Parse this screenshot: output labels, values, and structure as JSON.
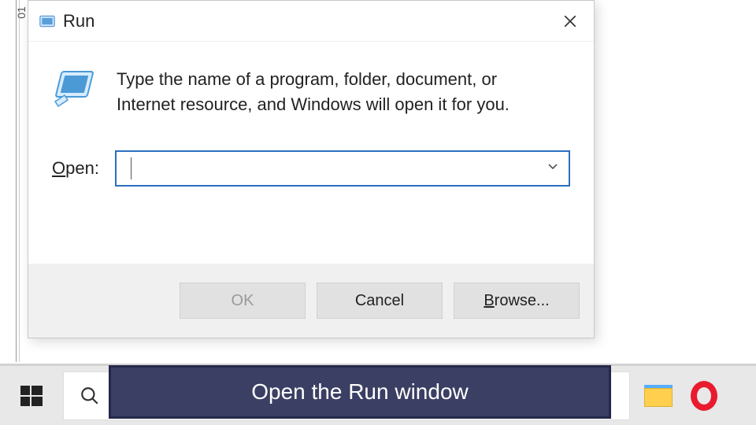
{
  "page_number": "01",
  "dialog": {
    "title": "Run",
    "description": "Type the name of a program, folder, document, or Internet resource, and Windows will open it for you.",
    "open_label_underlined": "O",
    "open_label_rest": "pen:",
    "input_value": "",
    "buttons": {
      "ok": "OK",
      "cancel": "Cancel",
      "browse_underlined": "B",
      "browse_rest": "rowse..."
    }
  },
  "annotation": "Open the Run window"
}
